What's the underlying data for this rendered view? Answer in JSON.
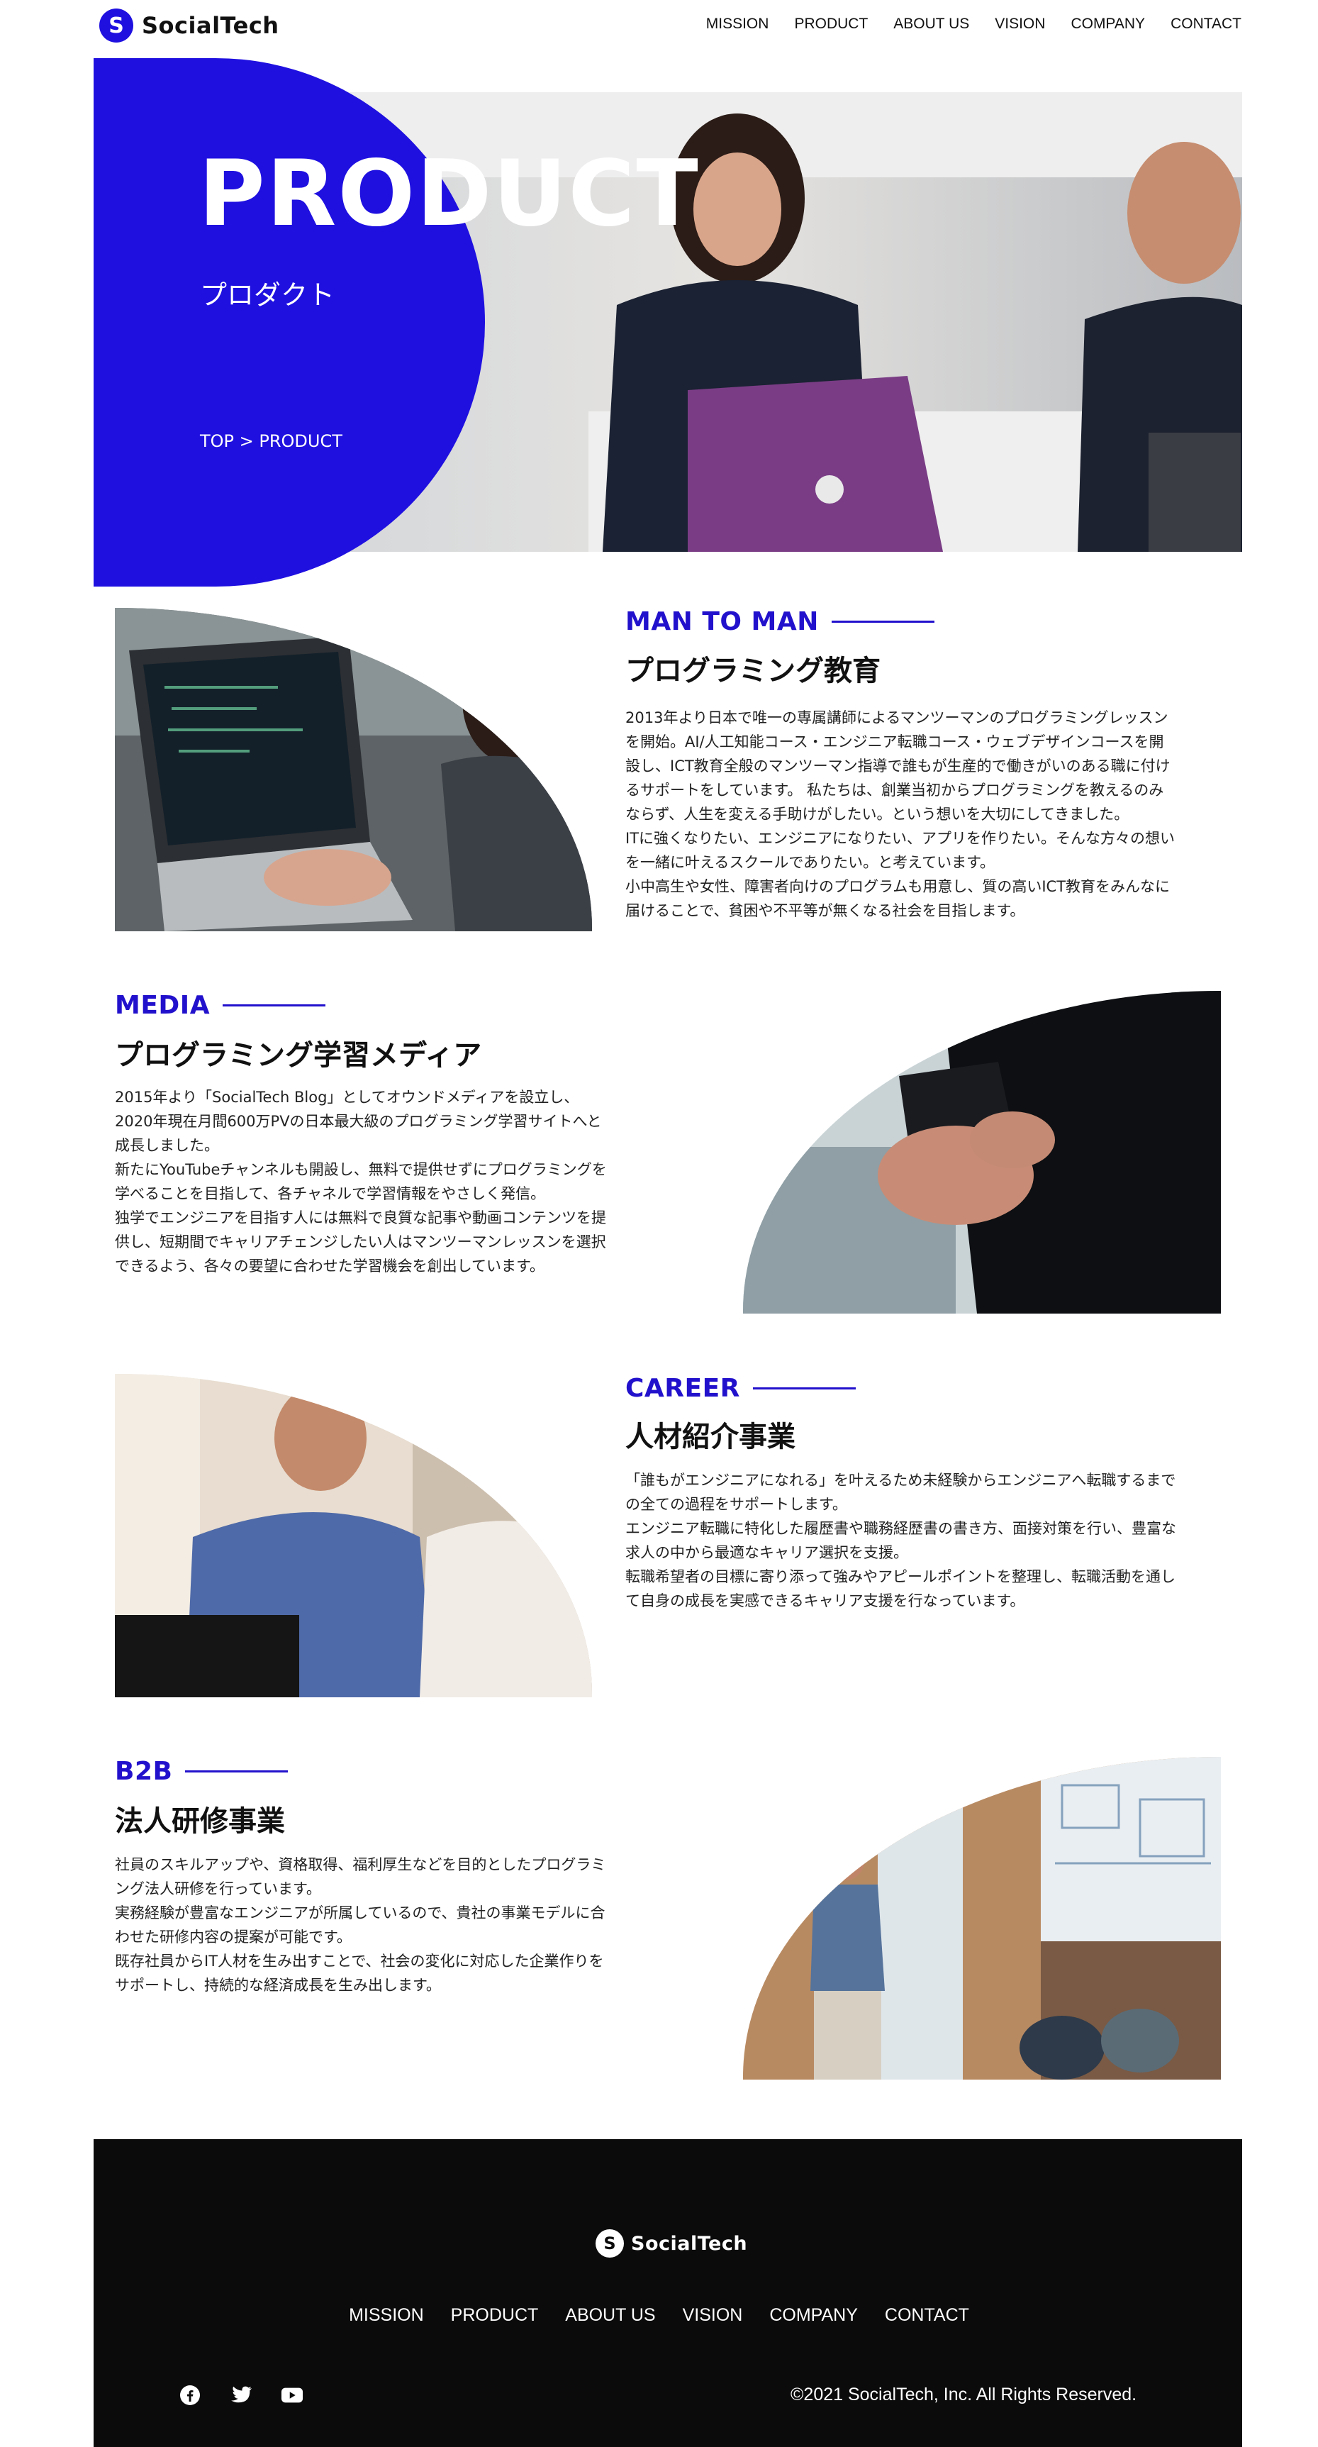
{
  "brand": {
    "name": "SocialTech",
    "accent": "#1f10e0"
  },
  "nav": [
    "MISSION",
    "PRODUCT",
    "ABOUT US",
    "VISION",
    "COMPANY",
    "CONTACT"
  ],
  "hero": {
    "title": "PRODUCT",
    "subtitle": "プロダクト",
    "breadcrumb": "TOP > PRODUCT"
  },
  "sections": [
    {
      "eyebrow": "MAN TO MAN",
      "heading": "プログラミング教育",
      "lines": [
        "2013年より日本で唯一の専属講師によるマンツーマンのプログラミングレッスン",
        "を開始。AI/人工知能コース・エンジニア転職コース・ウェブデザインコースを開",
        "設し、ICT教育全般のマンツーマン指導で誰もが生産的で働きがいのある職に付け",
        "るサポートをしています。 私たちは、創業当初からプログラミングを教えるのみ",
        "ならず、人生を変える手助けがしたい。という想いを大切にしてきました。",
        "ITに強くなりたい、エンジニアになりたい、アプリを作りたい。そんな方々の想い",
        "を一緒に叶えるスクールでありたい。と考えています。",
        "小中高生や女性、障害者向けのプログラムも用意し、質の高いICT教育をみんなに",
        "届けることで、貧困や不平等が無くなる社会を目指します。"
      ]
    },
    {
      "eyebrow": "MEDIA",
      "heading": "プログラミング学習メディア",
      "lines": [
        "2015年より「SocialTech Blog」としてオウンドメディアを設立し、",
        "2020年現在月間600万PVの日本最大級のプログラミング学習サイトへと",
        "成長しました。",
        "新たにYouTubeチャンネルも開設し、無料で提供せずにプログラミングを",
        "学べることを目指して、各チャネルで学習情報をやさしく発信。",
        "独学でエンジニアを目指す人には無料で良質な記事や動画コンテンツを提",
        "供し、短期間でキャリアチェンジしたい人はマンツーマンレッスンを選択",
        "できるよう、各々の要望に合わせた学習機会を創出しています。"
      ]
    },
    {
      "eyebrow": "CAREER",
      "heading": "人材紹介事業",
      "lines": [
        "「誰もがエンジニアになれる」を叶えるため未経験からエンジニアへ転職するまで",
        "の全ての過程をサポートします。",
        "エンジニア転職に特化した履歴書や職務経歴書の書き方、面接対策を行い、豊富な",
        "求人の中から最適なキャリア選択を支援。",
        "転職希望者の目標に寄り添って強みやアピールポイントを整理し、転職活動を通し",
        "て自身の成長を実感できるキャリア支援を行なっています。"
      ]
    },
    {
      "eyebrow": "B2B",
      "heading": "法人研修事業",
      "lines": [
        "社員のスキルアップや、資格取得、福利厚生などを目的としたプログラミ",
        "ング法人研修を行っています。",
        "実務経験が豊富なエンジニアが所属しているので、貴社の事業モデルに合",
        "わせた研修内容の提案が可能です。",
        "既存社員からIT人材を生み出すことで、社会の変化に対応した企業作りを",
        "サポートし、持続的な経済成長を生み出します。"
      ]
    }
  ],
  "footer": {
    "brand": "SocialTech",
    "nav": [
      "MISSION",
      "PRODUCT",
      "ABOUT US",
      "VISION",
      "COMPANY",
      "CONTACT"
    ],
    "social_icons": [
      "facebook-icon",
      "twitter-icon",
      "youtube-icon"
    ],
    "copyright": "©2021 SocialTech, Inc. All Rights Reserved."
  }
}
